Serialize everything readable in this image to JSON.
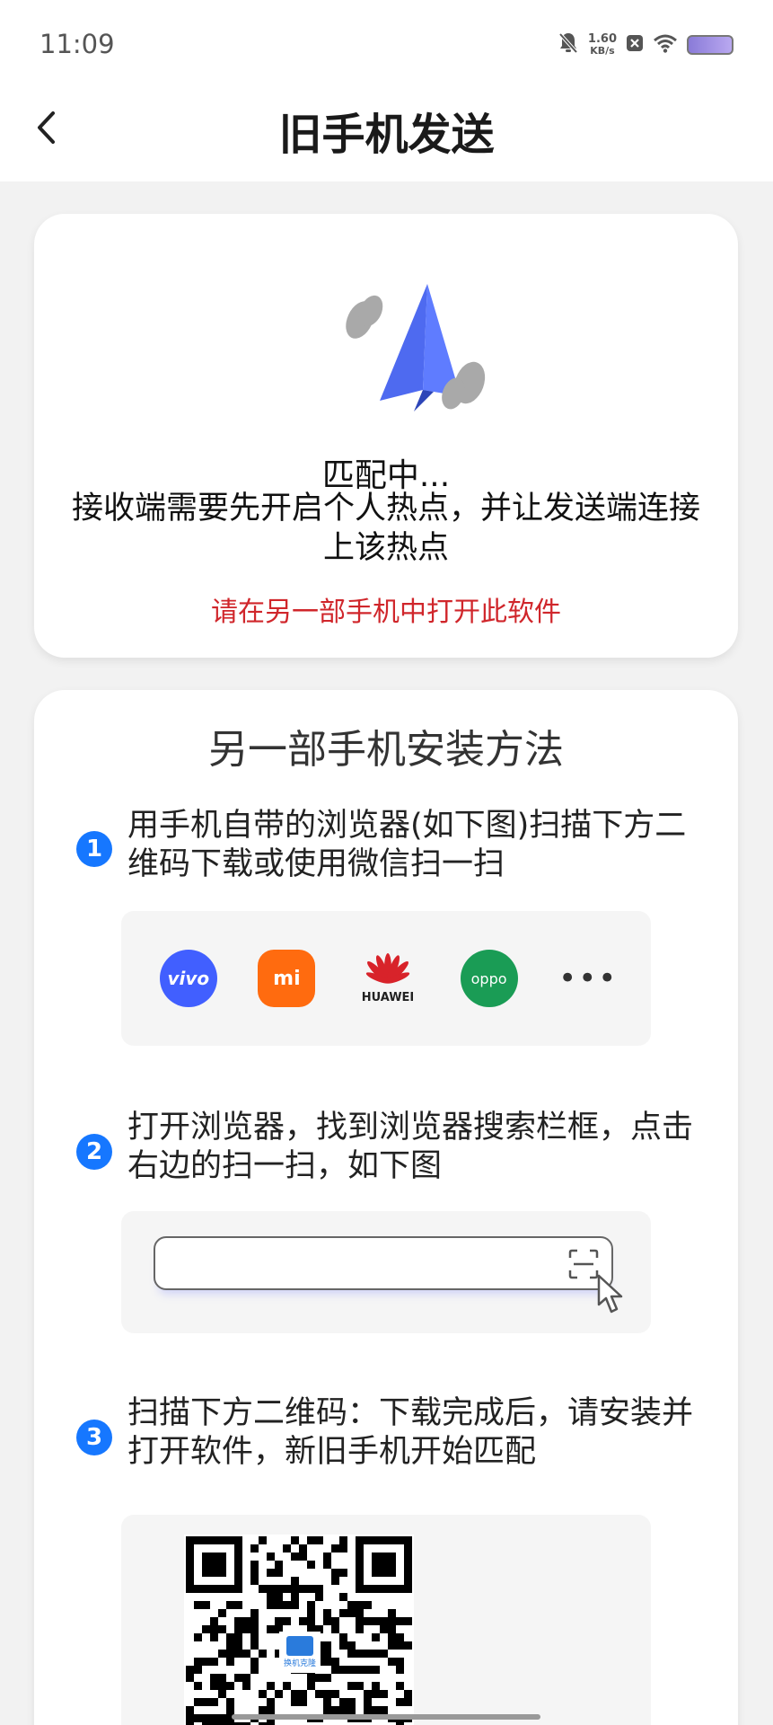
{
  "status_bar": {
    "time": "11:09",
    "net_speed_value": "1.60",
    "net_speed_unit": "KB/s",
    "icons": [
      "mute-icon",
      "notification-x-icon",
      "wifi-icon",
      "battery-icon"
    ]
  },
  "header": {
    "title": "旧手机发送",
    "back_icon": "chevron-left-icon"
  },
  "match_card": {
    "status": "匹配中...",
    "description": "接收端需要先开启个人热点，并让发送端连接上该热点",
    "warning": "请在另一部手机中打开此软件",
    "warning_color": "#d0262b"
  },
  "install_card": {
    "title": "另一部手机安装方法",
    "steps": [
      {
        "number": "1",
        "text": "用手机自带的浏览器(如下图)扫描下方二维码下载或使用微信扫一扫"
      },
      {
        "number": "2",
        "text": "打开浏览器，找到浏览器搜索栏框，点击右边的扫一扫，如下图"
      },
      {
        "number": "3",
        "text": "扫描下方二维码：下载完成后，请安装并打开软件，新旧手机开始匹配"
      }
    ],
    "browsers": [
      {
        "name": "vivo",
        "label": "vivo"
      },
      {
        "name": "xiaomi",
        "label": "mi"
      },
      {
        "name": "huawei",
        "label": "HUAWEI"
      },
      {
        "name": "oppo",
        "label": "oppo"
      }
    ],
    "more_label": "•••",
    "qr_logo_text": "换机克隆"
  },
  "accent_color": "#1677ff"
}
